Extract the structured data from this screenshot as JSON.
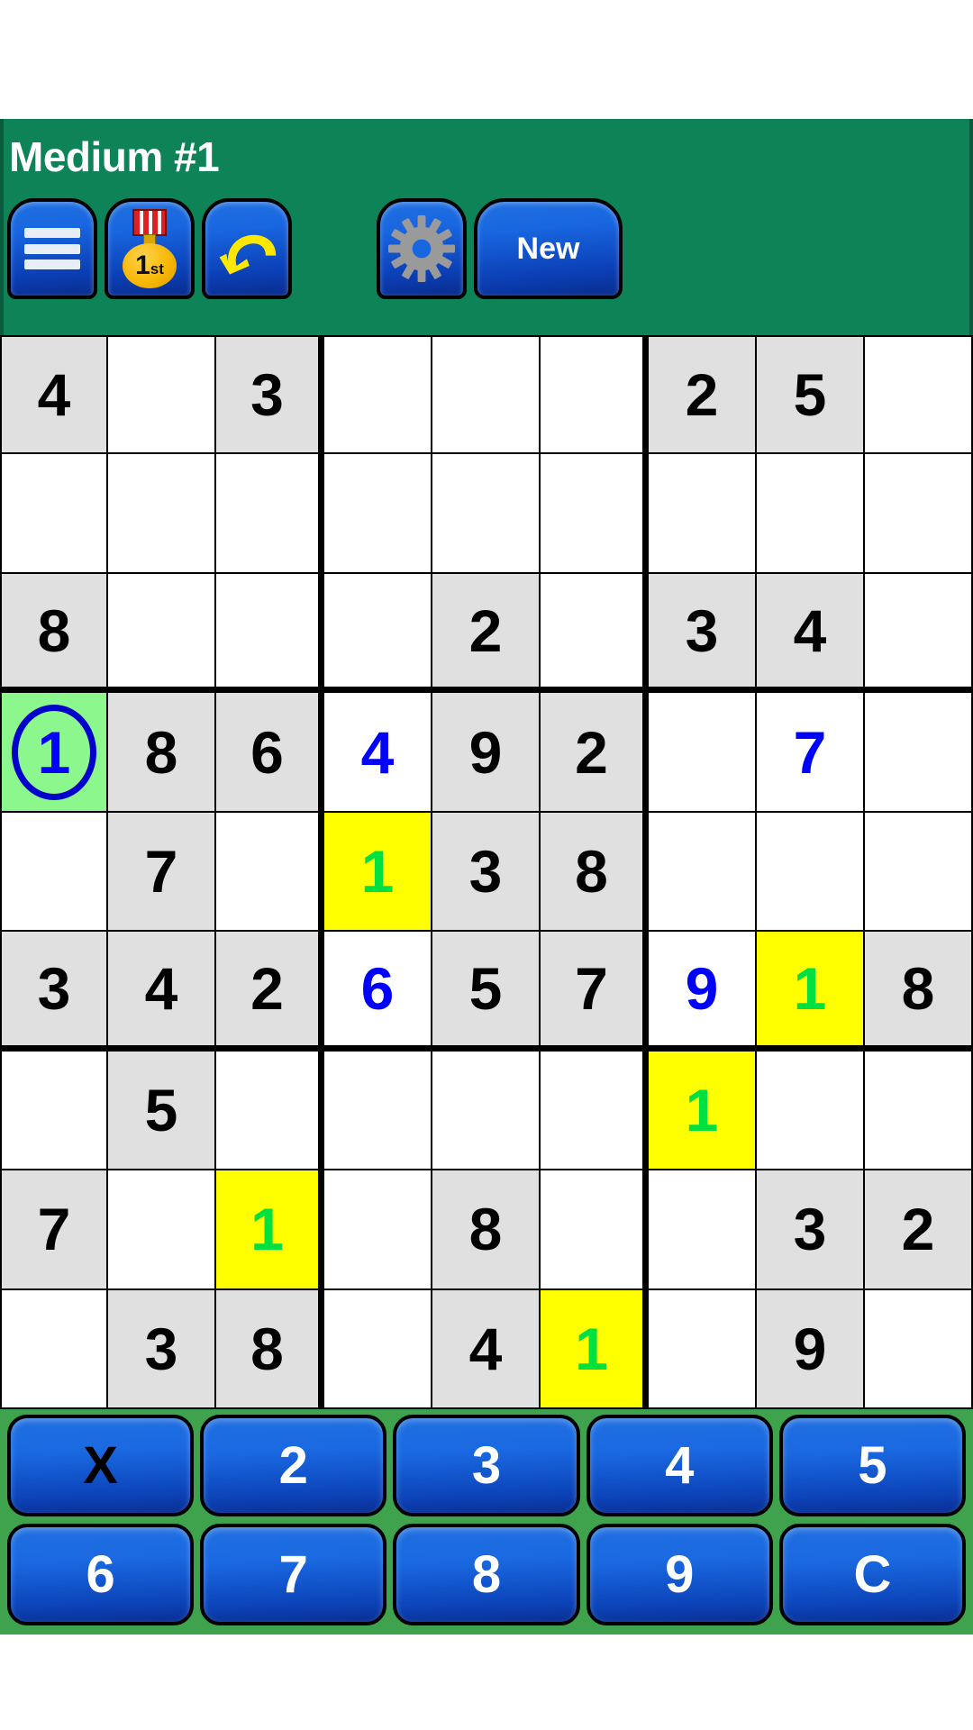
{
  "header": {
    "title": "Medium #1",
    "buttons": [
      {
        "name": "menu",
        "icon": "hamburger-menu-icon",
        "label": ""
      },
      {
        "name": "records",
        "icon": "medal-trophy-icon",
        "label": "1st"
      },
      {
        "name": "undo",
        "icon": "undo-arrow-icon",
        "label": ""
      },
      {
        "name": "settings",
        "icon": "gear-icon",
        "label": ""
      },
      {
        "name": "new-game",
        "icon": "",
        "label": "New"
      }
    ],
    "medal_rank": "1",
    "medal_suffix": "st",
    "new_label": "New"
  },
  "colors": {
    "header_bg": "#0d8357",
    "pad_bg": "#3fa34d",
    "button_blue": "#1866e0",
    "selected_cell": "#8cf78c",
    "highlight_cell": "#ffff00",
    "shaded_cell": "#e0e0e0",
    "given_digit": "#000000",
    "user_digit": "#0000ff",
    "hint_digit": "#00e040",
    "ring": "#0000cc"
  },
  "board": {
    "selected": {
      "row": 3,
      "col": 0,
      "value": "1"
    },
    "rows": [
      [
        {
          "v": "4",
          "s": "shade",
          "t": "given"
        },
        {
          "v": "",
          "s": "",
          "t": ""
        },
        {
          "v": "3",
          "s": "shade",
          "t": "given"
        },
        {
          "v": "",
          "s": "",
          "t": ""
        },
        {
          "v": "",
          "s": "",
          "t": ""
        },
        {
          "v": "",
          "s": "",
          "t": ""
        },
        {
          "v": "2",
          "s": "shade",
          "t": "given"
        },
        {
          "v": "5",
          "s": "shade",
          "t": "given"
        },
        {
          "v": "",
          "s": "",
          "t": ""
        }
      ],
      [
        {
          "v": "",
          "s": "",
          "t": ""
        },
        {
          "v": "",
          "s": "",
          "t": ""
        },
        {
          "v": "",
          "s": "",
          "t": ""
        },
        {
          "v": "",
          "s": "",
          "t": ""
        },
        {
          "v": "",
          "s": "",
          "t": ""
        },
        {
          "v": "",
          "s": "",
          "t": ""
        },
        {
          "v": "",
          "s": "",
          "t": ""
        },
        {
          "v": "",
          "s": "",
          "t": ""
        },
        {
          "v": "",
          "s": "",
          "t": ""
        }
      ],
      [
        {
          "v": "8",
          "s": "shade",
          "t": "given"
        },
        {
          "v": "",
          "s": "",
          "t": ""
        },
        {
          "v": "",
          "s": "",
          "t": ""
        },
        {
          "v": "",
          "s": "",
          "t": ""
        },
        {
          "v": "2",
          "s": "shade",
          "t": "given"
        },
        {
          "v": "",
          "s": "",
          "t": ""
        },
        {
          "v": "3",
          "s": "shade",
          "t": "given"
        },
        {
          "v": "4",
          "s": "shade",
          "t": "given"
        },
        {
          "v": "",
          "s": "",
          "t": ""
        }
      ],
      [
        {
          "v": "1",
          "s": "sel",
          "t": "user",
          "ring": true
        },
        {
          "v": "8",
          "s": "shade",
          "t": "given"
        },
        {
          "v": "6",
          "s": "shade",
          "t": "given"
        },
        {
          "v": "4",
          "s": "",
          "t": "user"
        },
        {
          "v": "9",
          "s": "shade",
          "t": "given"
        },
        {
          "v": "2",
          "s": "shade",
          "t": "given"
        },
        {
          "v": "",
          "s": "",
          "t": ""
        },
        {
          "v": "7",
          "s": "",
          "t": "user"
        },
        {
          "v": "",
          "s": "",
          "t": ""
        }
      ],
      [
        {
          "v": "",
          "s": "",
          "t": ""
        },
        {
          "v": "7",
          "s": "shade",
          "t": "given"
        },
        {
          "v": "",
          "s": "",
          "t": ""
        },
        {
          "v": "1",
          "s": "hl",
          "t": "hint"
        },
        {
          "v": "3",
          "s": "shade",
          "t": "given"
        },
        {
          "v": "8",
          "s": "shade",
          "t": "given"
        },
        {
          "v": "",
          "s": "",
          "t": ""
        },
        {
          "v": "",
          "s": "",
          "t": ""
        },
        {
          "v": "",
          "s": "",
          "t": ""
        }
      ],
      [
        {
          "v": "3",
          "s": "shade",
          "t": "given"
        },
        {
          "v": "4",
          "s": "shade",
          "t": "given"
        },
        {
          "v": "2",
          "s": "shade",
          "t": "given"
        },
        {
          "v": "6",
          "s": "",
          "t": "user"
        },
        {
          "v": "5",
          "s": "shade",
          "t": "given"
        },
        {
          "v": "7",
          "s": "shade",
          "t": "given"
        },
        {
          "v": "9",
          "s": "",
          "t": "user"
        },
        {
          "v": "1",
          "s": "hl",
          "t": "hint"
        },
        {
          "v": "8",
          "s": "shade",
          "t": "given"
        }
      ],
      [
        {
          "v": "",
          "s": "",
          "t": ""
        },
        {
          "v": "5",
          "s": "shade",
          "t": "given"
        },
        {
          "v": "",
          "s": "",
          "t": ""
        },
        {
          "v": "",
          "s": "",
          "t": ""
        },
        {
          "v": "",
          "s": "",
          "t": ""
        },
        {
          "v": "",
          "s": "",
          "t": ""
        },
        {
          "v": "1",
          "s": "hl",
          "t": "hint"
        },
        {
          "v": "",
          "s": "",
          "t": ""
        },
        {
          "v": "",
          "s": "",
          "t": ""
        }
      ],
      [
        {
          "v": "7",
          "s": "shade",
          "t": "given"
        },
        {
          "v": "",
          "s": "",
          "t": ""
        },
        {
          "v": "1",
          "s": "hl",
          "t": "hint"
        },
        {
          "v": "",
          "s": "",
          "t": ""
        },
        {
          "v": "8",
          "s": "shade",
          "t": "given"
        },
        {
          "v": "",
          "s": "",
          "t": ""
        },
        {
          "v": "",
          "s": "",
          "t": ""
        },
        {
          "v": "3",
          "s": "shade",
          "t": "given"
        },
        {
          "v": "2",
          "s": "shade",
          "t": "given"
        }
      ],
      [
        {
          "v": "",
          "s": "",
          "t": ""
        },
        {
          "v": "3",
          "s": "shade",
          "t": "given"
        },
        {
          "v": "8",
          "s": "shade",
          "t": "given"
        },
        {
          "v": "",
          "s": "",
          "t": ""
        },
        {
          "v": "4",
          "s": "shade",
          "t": "given"
        },
        {
          "v": "1",
          "s": "hl",
          "t": "hint"
        },
        {
          "v": "",
          "s": "",
          "t": ""
        },
        {
          "v": "9",
          "s": "shade",
          "t": "given"
        },
        {
          "v": "",
          "s": "",
          "t": ""
        }
      ]
    ]
  },
  "numpad": {
    "rows": [
      [
        "X",
        "2",
        "3",
        "4",
        "5"
      ],
      [
        "6",
        "7",
        "8",
        "9",
        "C"
      ]
    ]
  }
}
